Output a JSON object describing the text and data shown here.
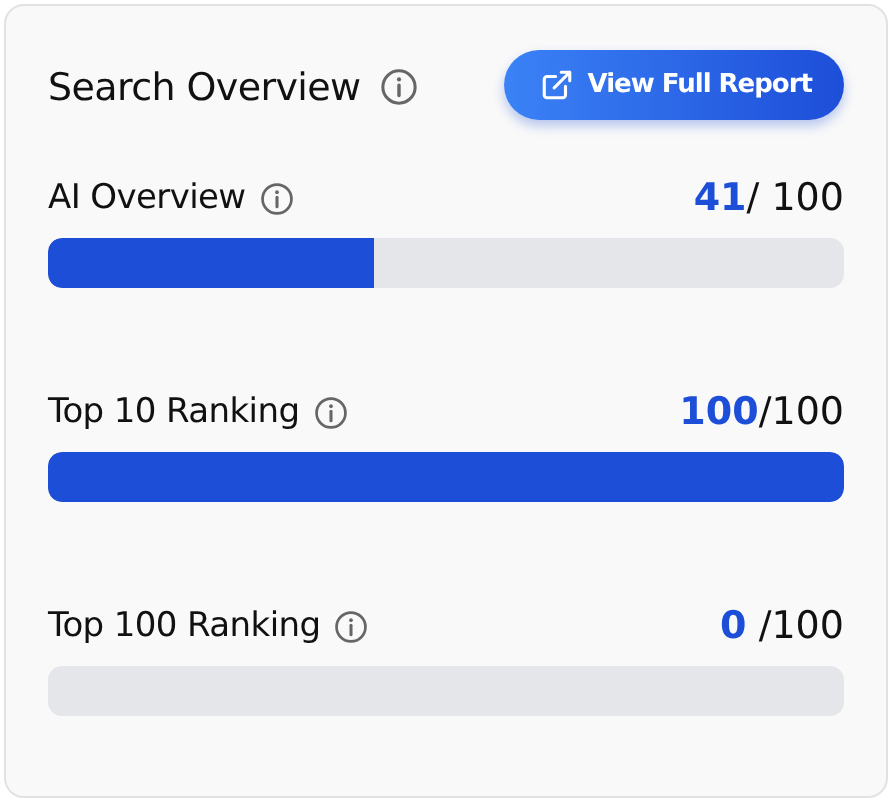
{
  "title": "Search Overview",
  "button": {
    "label": "View Full Report"
  },
  "metrics": [
    {
      "name": "AI Overview",
      "value": "41",
      "total": "/ 100",
      "level": 0.41
    },
    {
      "name": "Top 10 Ranking",
      "value": "100",
      "total": "/100",
      "level": 1
    },
    {
      "name": "Top 100 Ranking",
      "value": "0",
      "total": " /100"
    }
  ]
}
